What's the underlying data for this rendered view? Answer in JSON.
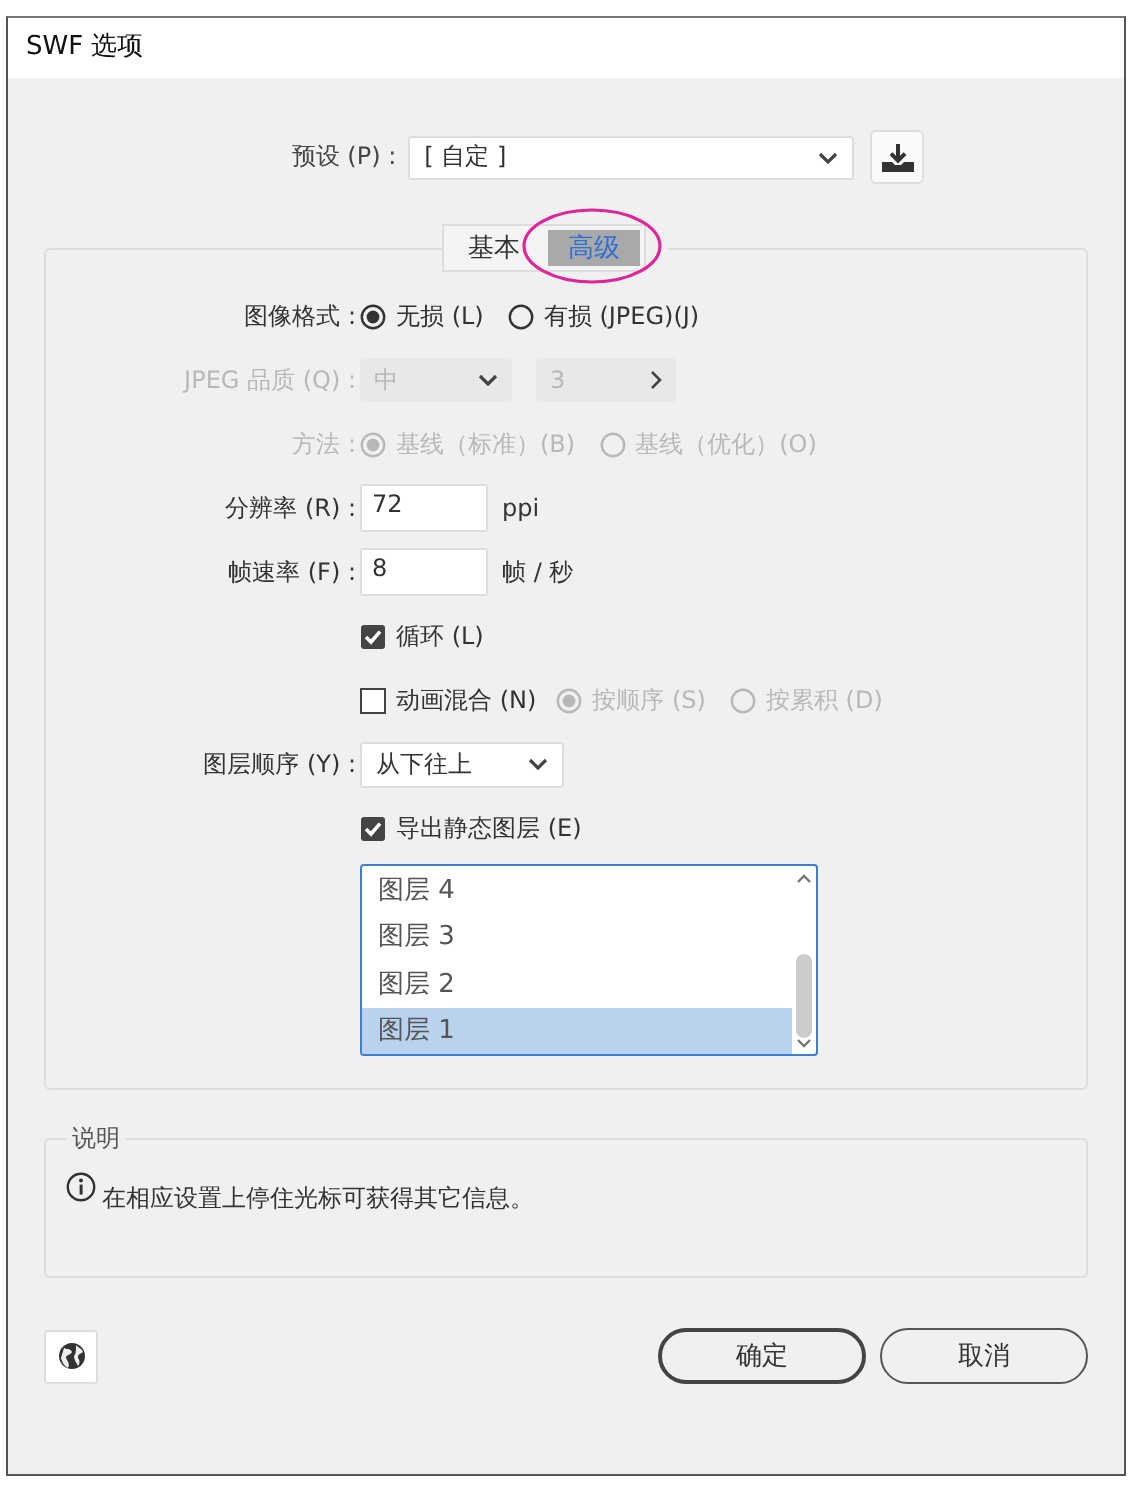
{
  "window": {
    "title": "SWF 选项"
  },
  "preset": {
    "label": "预设 (P) :",
    "value": "[ 自定 ]"
  },
  "tabs": [
    {
      "label": "基本",
      "selected": false,
      "circled": false
    },
    {
      "label": "高级",
      "selected": true,
      "circled": true
    }
  ],
  "rows": [
    {
      "kind": "radios",
      "label": "图像格式 :",
      "options": [
        {
          "label": "无损 (L)",
          "selected": true
        },
        {
          "label": "有损 (JPEG)(J)",
          "selected": false
        }
      ]
    },
    {
      "kind": "quality",
      "label": "JPEG 品质 (Q) :",
      "disabled": true,
      "select": "中",
      "value": "3"
    },
    {
      "kind": "radios",
      "label": "方法 :",
      "disabled": true,
      "options": [
        {
          "label": "基线（标准）(B)",
          "selected": true
        },
        {
          "label": "基线（优化）(O)",
          "selected": false
        }
      ]
    },
    {
      "kind": "input",
      "label": "分辨率 (R) :",
      "value": "72",
      "unit": "ppi"
    },
    {
      "kind": "input",
      "label": "帧速率 (F) :",
      "value": "8",
      "unit": "帧 / 秒"
    },
    {
      "kind": "checkbox",
      "label": "循环 (L)",
      "checked": true
    },
    {
      "kind": "checkbox",
      "label": "动画混合 (N)",
      "checked": false,
      "options_disabled": true,
      "options": [
        {
          "label": "按顺序 (S)",
          "selected": true
        },
        {
          "label": "按累积 (D)",
          "selected": false
        }
      ]
    },
    {
      "kind": "select",
      "label": "图层顺序 (Y) :",
      "value": "从下往上"
    },
    {
      "kind": "checkbox",
      "label": "导出静态图层 (E)",
      "checked": true
    },
    {
      "kind": "list",
      "items": [
        {
          "label": "图层 4",
          "selected": false
        },
        {
          "label": "图层 3",
          "selected": false
        },
        {
          "label": "图层 2",
          "selected": false
        },
        {
          "label": "图层 1",
          "selected": true
        }
      ]
    }
  ],
  "description": {
    "title": "说明",
    "text": "在相应设置上停住光标可获得其它信息。"
  },
  "buttons": [
    {
      "label": "确定",
      "default": true
    },
    {
      "label": "取消",
      "default": false
    }
  ]
}
